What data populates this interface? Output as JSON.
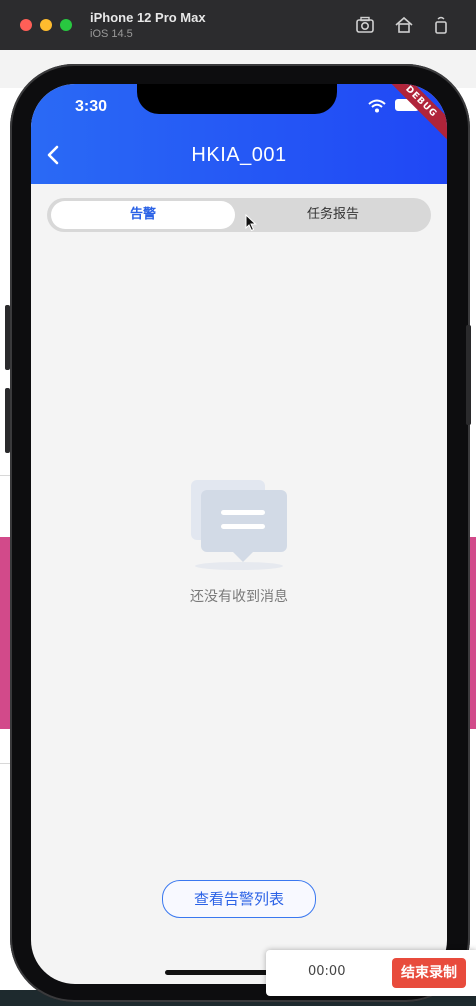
{
  "simulator": {
    "device_name": "iPhone 12 Pro Max",
    "os_version": "iOS 14.5"
  },
  "status_bar": {
    "time": "3:30",
    "debug_banner": "DEBUG"
  },
  "app_bar": {
    "title": "HKIA_001"
  },
  "tabs": [
    {
      "label": "告警",
      "active": true
    },
    {
      "label": "任务报告",
      "active": false
    }
  ],
  "empty_state": {
    "message": "还没有收到消息"
  },
  "actions": {
    "view_alarm_list": "查看告警列表"
  },
  "recorder": {
    "elapsed": "00:00",
    "stop_label": "结束录制"
  },
  "colors": {
    "appbar_start": "#2a6af5",
    "appbar_end": "#2047f5",
    "accent": "#2b62e6",
    "stop_button": "#e84b3c"
  }
}
